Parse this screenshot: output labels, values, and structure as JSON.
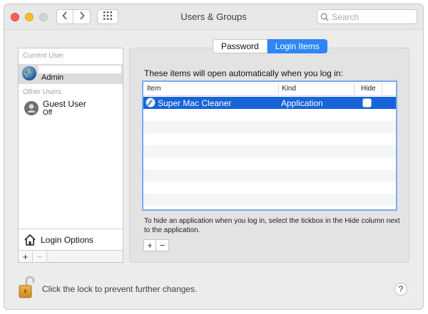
{
  "window": {
    "title": "Users & Groups",
    "search": {
      "placeholder": "Search",
      "value": ""
    }
  },
  "toolbar": {
    "back_icon": "chevron-left-icon",
    "forward_icon": "chevron-right-icon",
    "grid_icon": "show-all-grid-icon"
  },
  "sidebar": {
    "current_user_label": "Current User",
    "current_user": {
      "name": "Admin",
      "avatar_icon": "earth-globe-icon"
    },
    "other_users_label": "Other Users",
    "other_users": [
      {
        "name": "Guest User",
        "status": "Off",
        "avatar_icon": "person-silhouette-icon"
      }
    ],
    "login_options_label": "Login Options",
    "add_label": "+",
    "remove_label": "−"
  },
  "tabs": [
    {
      "label": "Password",
      "active": false
    },
    {
      "label": "Login Items",
      "active": true
    }
  ],
  "login_items": {
    "description": "These items will open automatically when you log in:",
    "columns": {
      "item": "Item",
      "kind": "Kind",
      "hide": "Hide"
    },
    "rows": [
      {
        "item": "Super Mac Cleaner",
        "kind": "Application",
        "hide": false,
        "selected": true
      }
    ],
    "hint": "To hide an application when you log in, select the tickbox in the Hide column next to the application.",
    "add_label": "+",
    "remove_label": "−"
  },
  "footer": {
    "lock_text": "Click the lock to prevent further changes.",
    "help_label": "?"
  },
  "colors": {
    "accent": "#2f86f6",
    "selection": "#1664d8",
    "table_focus": "#7aaaf1"
  }
}
